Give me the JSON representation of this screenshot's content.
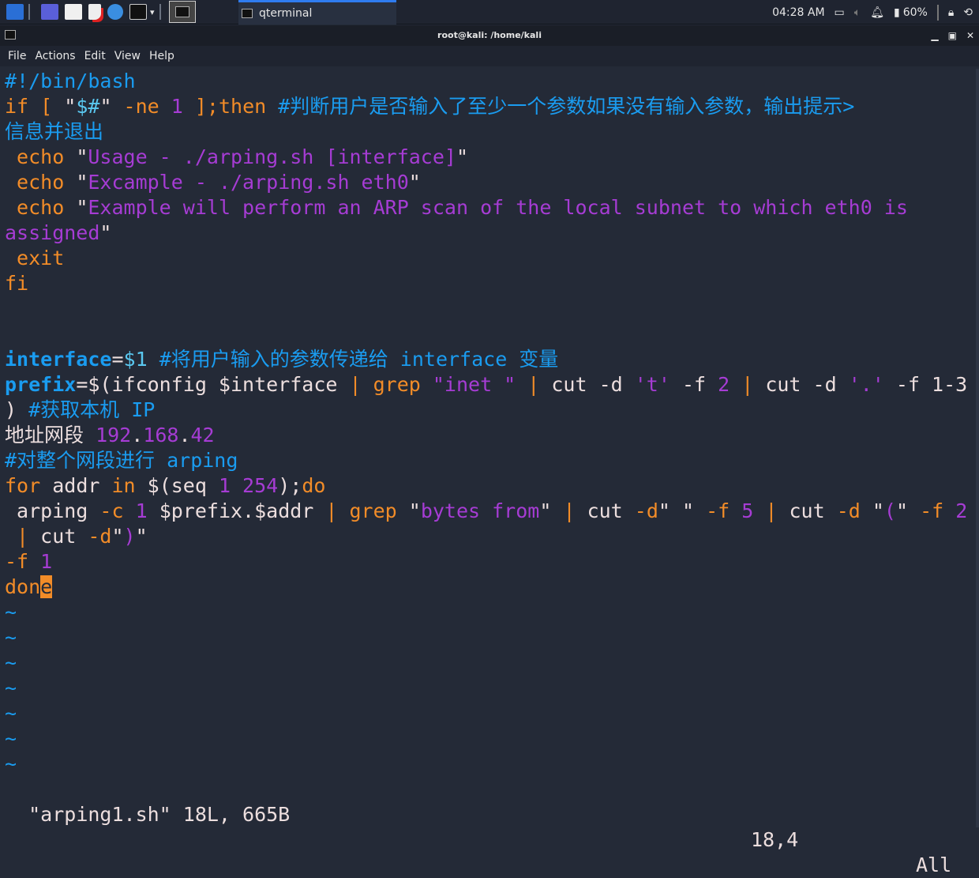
{
  "taskbar": {
    "task_label": "qterminal",
    "clock": "04:28 AM",
    "battery": "60%",
    "icons": [
      "kali-menu-icon",
      "desktop-icon",
      "file-manager-icon",
      "text-editor-icon",
      "browser-icon",
      "terminal-icon",
      "terminal-window-icon"
    ]
  },
  "window": {
    "title": "root@kali: /home/kali"
  },
  "menu": [
    "File",
    "Actions",
    "Edit",
    "View",
    "Help"
  ],
  "colors": {
    "orange": "#f28c28",
    "blue": "#1a9cf0",
    "purple": "#a63cd4",
    "text": "#ecdede",
    "background": "#242a37"
  },
  "lines": [
    [
      [
        "b",
        "#!/bin/bash"
      ]
    ],
    [
      [
        "o",
        "if [ "
      ],
      [
        "w",
        "\""
      ],
      [
        "c",
        "$#"
      ],
      [
        "w",
        "\""
      ],
      [
        "o",
        " -ne "
      ],
      [
        "p",
        "1"
      ],
      [
        "o",
        " ];then "
      ],
      [
        "b",
        "#判断用户是否输入了至少一个参数如果没有输入参数，输出提示>"
      ]
    ],
    [
      [
        "b",
        "信息并退出"
      ]
    ],
    [
      [
        "o",
        " echo "
      ],
      [
        "w",
        "\""
      ],
      [
        "p",
        "Usage - ./arping.sh [interface]"
      ],
      [
        "w",
        "\""
      ]
    ],
    [
      [
        "o",
        " echo "
      ],
      [
        "w",
        "\""
      ],
      [
        "p",
        "Excample - ./arping.sh eth0"
      ],
      [
        "w",
        "\""
      ]
    ],
    [
      [
        "o",
        " echo "
      ],
      [
        "w",
        "\""
      ],
      [
        "p",
        "Example will perform an ARP scan of the local subnet to which eth0 is"
      ]
    ],
    [
      [
        "p",
        "assigned"
      ],
      [
        "w",
        "\""
      ]
    ],
    [
      [
        "o",
        " exit"
      ]
    ],
    [
      [
        "o",
        "fi"
      ]
    ],
    [],
    [],
    [
      [
        "bb",
        "interface"
      ],
      [
        "w",
        "="
      ],
      [
        "c",
        "$1"
      ],
      [
        "b",
        " #将用户输入的参数传递给 interface 变量"
      ]
    ],
    [
      [
        "bb",
        "prefix"
      ],
      [
        "w",
        "=$(ifconfig $interface "
      ],
      [
        "o",
        "| grep "
      ],
      [
        "p",
        "\"inet \""
      ],
      [
        "o",
        " | "
      ],
      [
        "w",
        "cut -d "
      ],
      [
        "p",
        "'t'"
      ],
      [
        "w",
        " -f "
      ],
      [
        "p",
        "2"
      ],
      [
        "o",
        " | "
      ],
      [
        "w",
        "cut -d "
      ],
      [
        "p",
        "'.'"
      ],
      [
        "w",
        " -f 1-3"
      ]
    ],
    [
      [
        "w",
        ") "
      ],
      [
        "b",
        "#获取本机 IP"
      ]
    ],
    [
      [
        "w",
        "地址网段 "
      ],
      [
        "p",
        "192"
      ],
      [
        "w",
        "."
      ],
      [
        "p",
        "168"
      ],
      [
        "w",
        "."
      ],
      [
        "p",
        "42"
      ]
    ],
    [
      [
        "b",
        "#对整个网段进行 arping"
      ]
    ],
    [
      [
        "o",
        "for "
      ],
      [
        "w",
        "addr "
      ],
      [
        "o",
        "in "
      ],
      [
        "w",
        "$(seq "
      ],
      [
        "p",
        "1 254"
      ],
      [
        "w",
        ");"
      ],
      [
        "o",
        "do"
      ]
    ],
    [
      [
        "w",
        " arping "
      ],
      [
        "o",
        "-c "
      ],
      [
        "p",
        "1 "
      ],
      [
        "w",
        "$prefix.$addr "
      ],
      [
        "o",
        "| grep "
      ],
      [
        "w",
        "\""
      ],
      [
        "p",
        "bytes from"
      ],
      [
        "w",
        "\""
      ],
      [
        "o",
        " | "
      ],
      [
        "w",
        "cut "
      ],
      [
        "o",
        "-d"
      ],
      [
        "w",
        "\" \""
      ],
      [
        "o",
        " -f "
      ],
      [
        "p",
        "5"
      ],
      [
        "o",
        " | "
      ],
      [
        "w",
        "cut "
      ],
      [
        "o",
        "-d "
      ],
      [
        "w",
        "\""
      ],
      [
        "p",
        "("
      ],
      [
        "w",
        "\""
      ],
      [
        "o",
        " -f "
      ],
      [
        "p",
        "2"
      ]
    ],
    [
      [
        "o",
        " | "
      ],
      [
        "w",
        "cut "
      ],
      [
        "o",
        "-d"
      ],
      [
        "w",
        "\""
      ],
      [
        "p",
        ")"
      ],
      [
        "w",
        "\""
      ]
    ],
    [
      [
        "o",
        "-f "
      ],
      [
        "p",
        "1"
      ]
    ],
    [
      [
        "o",
        "don"
      ],
      [
        "cur",
        "e"
      ]
    ],
    [
      [
        "b",
        "~"
      ]
    ],
    [
      [
        "b",
        "~"
      ]
    ],
    [
      [
        "b",
        "~"
      ]
    ],
    [
      [
        "b",
        "~"
      ]
    ],
    [
      [
        "b",
        "~"
      ]
    ],
    [
      [
        "b",
        "~"
      ]
    ],
    [
      [
        "b",
        "~"
      ]
    ]
  ],
  "status": {
    "file": "\"arping1.sh\" 18L, 665B",
    "position": "18,4",
    "scroll": "All"
  }
}
